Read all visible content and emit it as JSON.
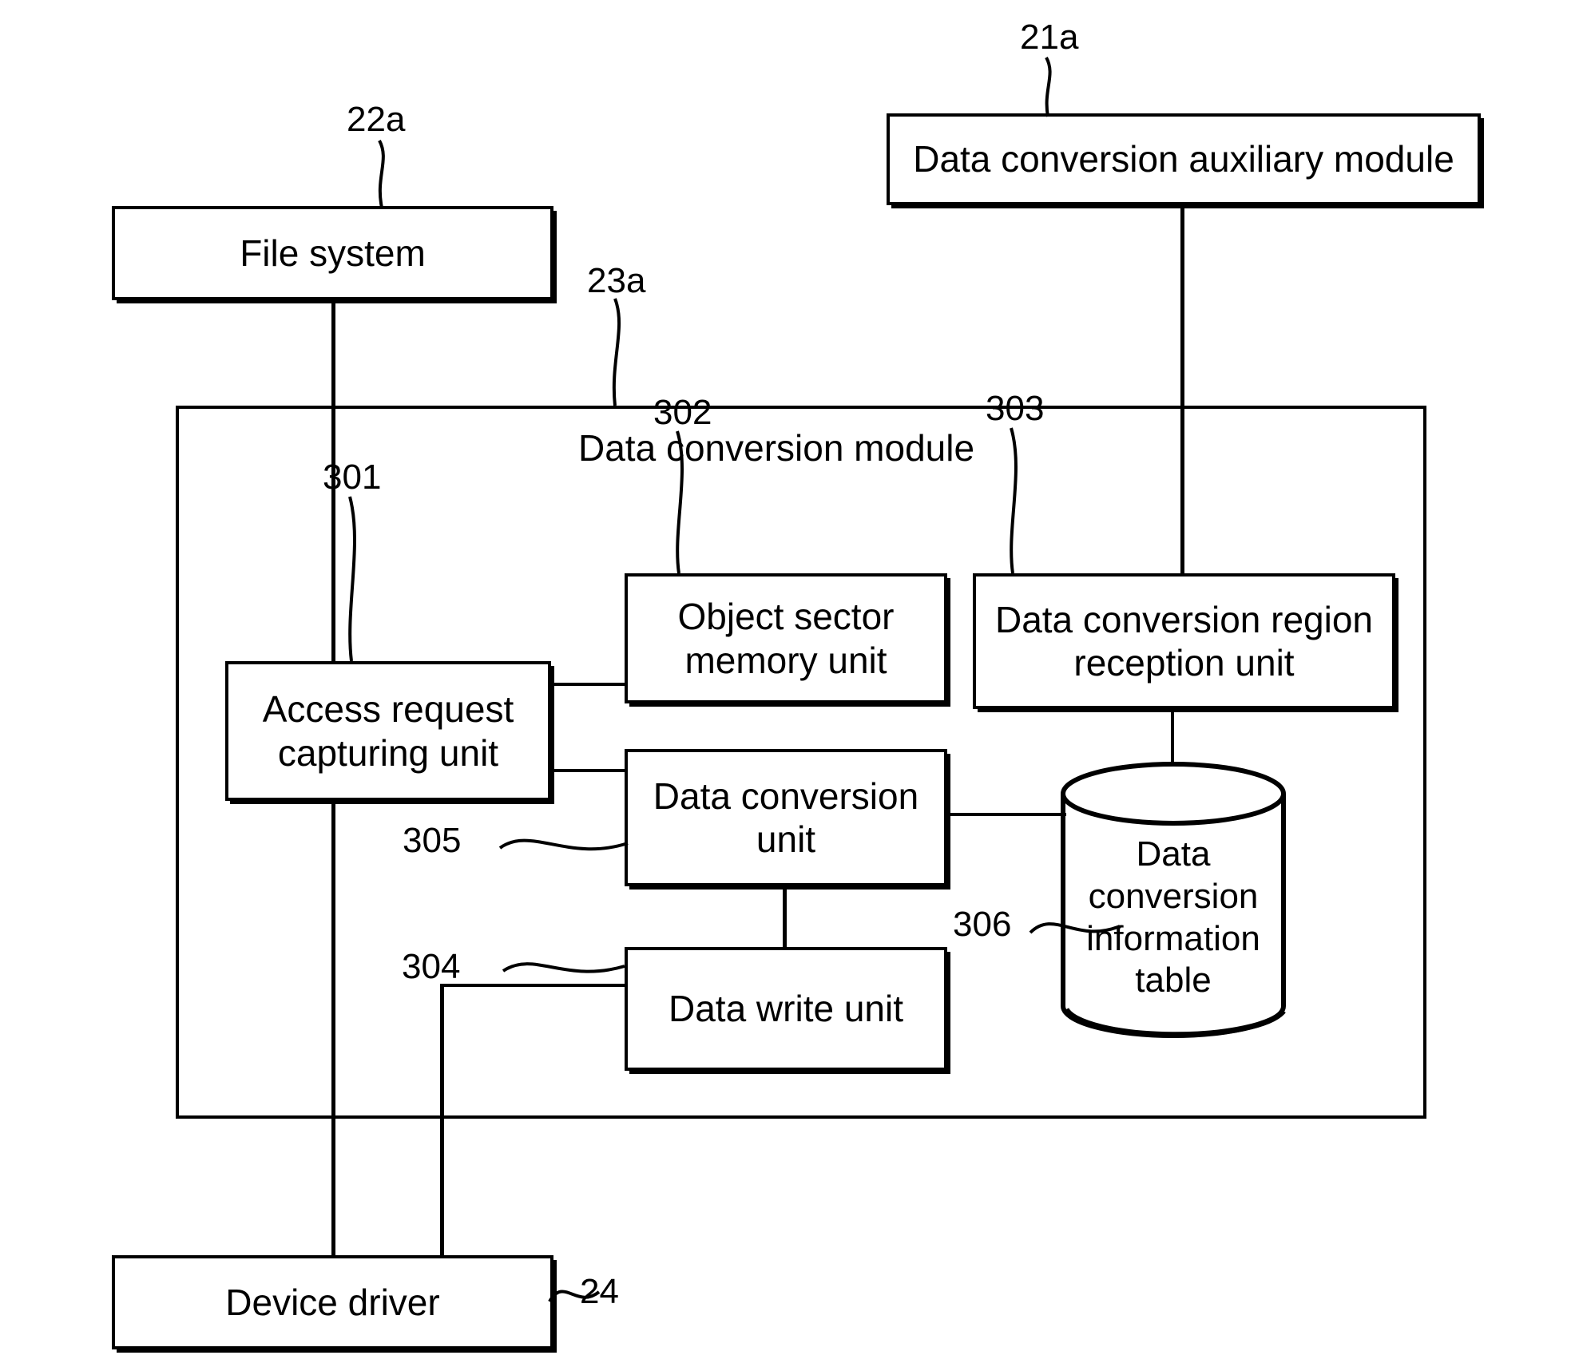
{
  "figure": {
    "blocks": {
      "data_conversion_auxiliary_module": {
        "label": "Data conversion auxiliary module",
        "ref": "21a"
      },
      "file_system": {
        "label": "File system",
        "ref": "22a"
      },
      "data_conversion_module": {
        "label": "Data conversion module",
        "ref": "23a"
      },
      "access_request_capturing_unit": {
        "label": "Access request\ncapturing unit",
        "ref": "301"
      },
      "object_sector_memory_unit": {
        "label": "Object sector\nmemory unit",
        "ref": "302"
      },
      "data_conversion_region_reception_unit": {
        "label": "Data conversion region\nreception unit",
        "ref": "303"
      },
      "data_write_unit": {
        "label": "Data write unit",
        "ref": "304"
      },
      "data_conversion_unit": {
        "label": "Data conversion\nunit",
        "ref": "305"
      },
      "data_conversion_information_table": {
        "label": "Data\nconversion\ninformation\ntable",
        "ref": "306"
      },
      "device_driver": {
        "label": "Device driver",
        "ref": "24"
      }
    },
    "colors": {
      "stroke": "#000000",
      "background": "#ffffff"
    }
  }
}
